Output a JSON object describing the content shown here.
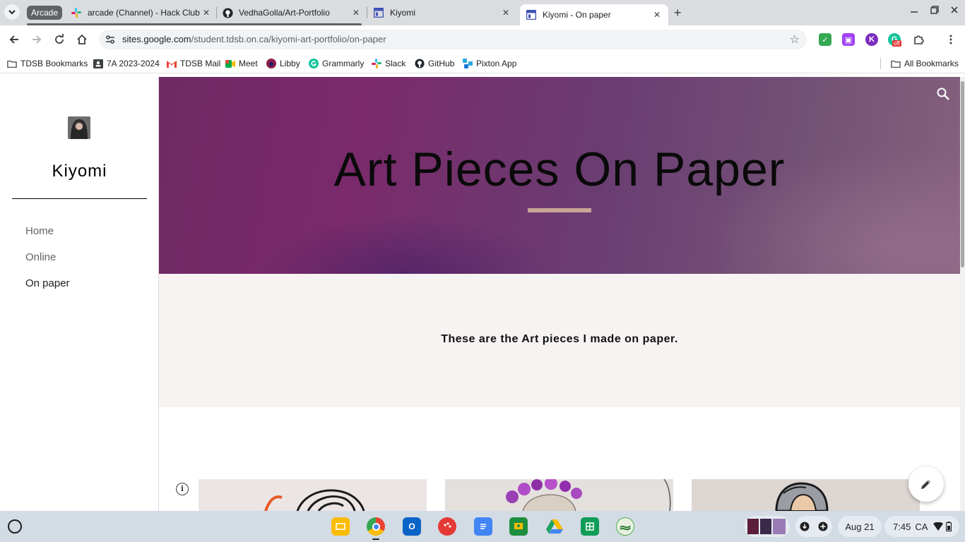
{
  "browser": {
    "tab_group_label": "Arcade",
    "tabs": [
      {
        "title": "arcade (Channel) - Hack Club -",
        "favicon": "slack-icon"
      },
      {
        "title": "VedhaGolla/Art-Portfolio",
        "favicon": "github-icon"
      },
      {
        "title": "Kiyomi",
        "favicon": "google-sites-icon"
      },
      {
        "title": "Kiyomi - On paper",
        "favicon": "google-sites-icon",
        "active": true
      }
    ],
    "url_host": "sites.google.com",
    "url_path": "/student.tdsb.on.ca/kiyomi-art-portfolio/on-paper",
    "extension_badge": "off",
    "bookmarks": [
      {
        "label": "TDSB Bookmarks",
        "icon": "folder-icon"
      },
      {
        "label": "7A 2023-2024",
        "icon": "classroom-icon"
      },
      {
        "label": "TDSB Mail",
        "icon": "gmail-icon"
      },
      {
        "label": "Meet",
        "icon": "meet-icon"
      },
      {
        "label": "Libby",
        "icon": "libby-icon"
      },
      {
        "label": "Grammarly",
        "icon": "grammarly-icon"
      },
      {
        "label": "Slack",
        "icon": "slack-icon"
      },
      {
        "label": "GitHub",
        "icon": "github-icon"
      },
      {
        "label": "Pixton App",
        "icon": "pixton-icon"
      }
    ],
    "all_bookmarks": "All Bookmarks"
  },
  "site": {
    "title": "Kiyomi",
    "nav": [
      {
        "label": "Home",
        "current": false
      },
      {
        "label": "Online",
        "current": false
      },
      {
        "label": "On paper",
        "current": true
      }
    ],
    "hero_title": "Art Pieces On Paper",
    "intro": "These are the Art pieces I made on paper.",
    "colors": {
      "hero": "#7a2a6a",
      "accent_bar": "#c8a596",
      "intro_bg": "#f7f3f2"
    }
  },
  "shelf": {
    "apps": [
      "slides-icon",
      "chrome-icon",
      "outlook-icon",
      "paint-icon",
      "docs-icon",
      "classroom-icon",
      "drive-icon",
      "sheets-icon",
      "earth-icon"
    ],
    "date": "Aug 21",
    "time": "7:45",
    "region": "CA"
  }
}
